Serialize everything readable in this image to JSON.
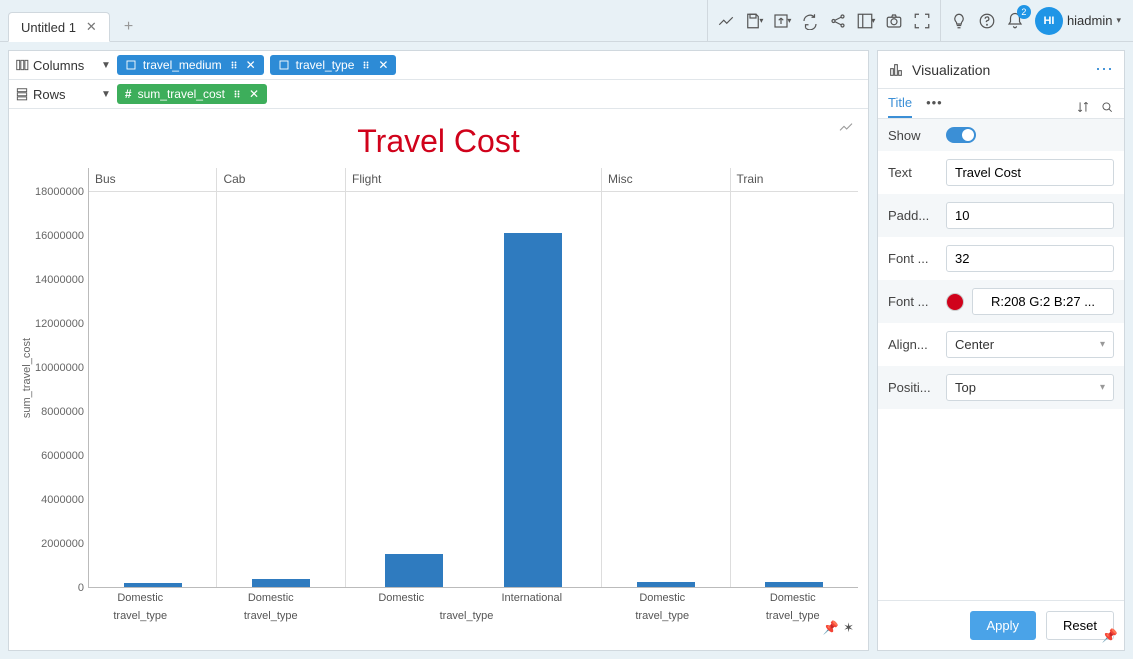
{
  "top": {
    "tab_title": "Untitled 1",
    "notification_count": "2",
    "user_initials": "HI",
    "user_name": "hiadmin"
  },
  "shelves": {
    "columns_label": "Columns",
    "rows_label": "Rows",
    "col_pills": [
      "travel_medium",
      "travel_type"
    ],
    "row_pills": [
      "sum_travel_cost"
    ]
  },
  "panel": {
    "title": "Visualization",
    "tab_title": "Title",
    "props": {
      "show_label": "Show",
      "text_label": "Text",
      "text_value": "Travel Cost",
      "padding_label": "Padd...",
      "padding_value": "10",
      "fontsize_label": "Font ...",
      "fontsize_value": "32",
      "fontcolor_label": "Font ...",
      "fontcolor_value": "R:208 G:2 B:27 ...",
      "align_label": "Align...",
      "align_value": "Center",
      "position_label": "Positi...",
      "position_value": "Top"
    },
    "apply": "Apply",
    "reset": "Reset"
  },
  "chart_data": {
    "type": "bar",
    "title": "Travel Cost",
    "ylabel": "sum_travel_cost",
    "ylim": [
      0,
      18000000
    ],
    "yticks": [
      18000000,
      16000000,
      14000000,
      12000000,
      10000000,
      8000000,
      6000000,
      4000000,
      2000000,
      0
    ],
    "x_inner_axis": "travel_type",
    "facets": [
      {
        "name": "Bus",
        "width": 1,
        "bars": [
          {
            "cat": "Domestic",
            "value": 170000
          }
        ]
      },
      {
        "name": "Cab",
        "width": 1,
        "bars": [
          {
            "cat": "Domestic",
            "value": 350000
          }
        ]
      },
      {
        "name": "Flight",
        "width": 2,
        "bars": [
          {
            "cat": "Domestic",
            "value": 1500000
          },
          {
            "cat": "International",
            "value": 16100000
          }
        ]
      },
      {
        "name": "Misc",
        "width": 1,
        "bars": [
          {
            "cat": "Domestic",
            "value": 220000
          }
        ]
      },
      {
        "name": "Train",
        "width": 1,
        "bars": [
          {
            "cat": "Domestic",
            "value": 250000
          }
        ]
      }
    ]
  }
}
